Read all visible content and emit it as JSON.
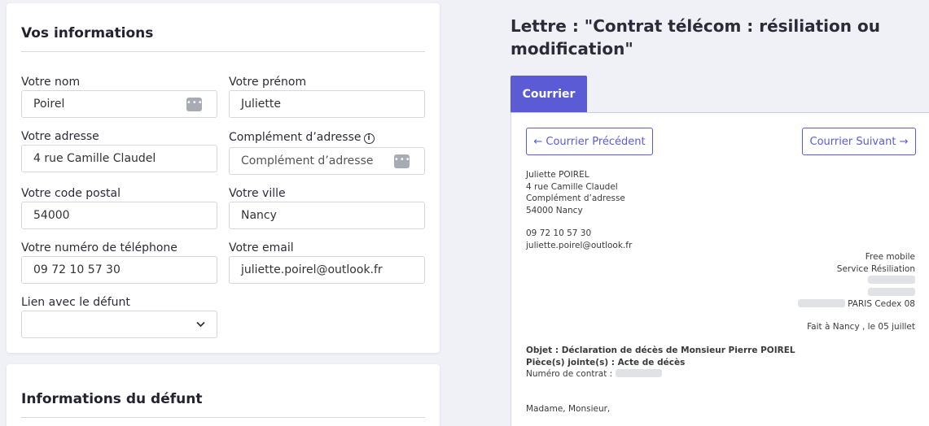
{
  "form": {
    "section_title": "Vos informations",
    "nom": {
      "label": "Votre nom",
      "value": "Poirel"
    },
    "prenom": {
      "label": "Votre prénom",
      "value": "Juliette"
    },
    "adresse": {
      "label": "Votre adresse",
      "value": "4 rue Camille Claudel"
    },
    "complement": {
      "label": "Complément d’adresse",
      "placeholder": "Complément d’adresse"
    },
    "code_postal": {
      "label": "Votre code postal",
      "value": "54000"
    },
    "ville": {
      "label": "Votre ville",
      "value": "Nancy"
    },
    "telephone": {
      "label": "Votre numéro de téléphone",
      "value": "09 72 10 57 30"
    },
    "email": {
      "label": "Votre email",
      "value": "juliette.poirel@outlook.fr"
    },
    "lien": {
      "label": "Lien avec le défunt",
      "value": ""
    }
  },
  "defunt": {
    "section_title": "Informations du défunt"
  },
  "letter": {
    "title": "Lettre : \"Contrat télécom : résiliation ou modification\"",
    "tab_label": "Courrier",
    "prev_label": "← Courrier Précédent",
    "next_label": "Courrier Suivant →",
    "sender": [
      "Juliette POIREL",
      "4 rue Camille Claudel",
      "Complément d’adresse",
      "54000 Nancy"
    ],
    "phone": "09 72 10 57 30",
    "email": "juliette.poirel@outlook.fr",
    "recipient_name": "Free mobile",
    "recipient_service": "Service Résiliation",
    "recipient_city": "PARIS Cedex 08",
    "place_date": "Fait à Nancy , le 05 juillet",
    "objet": "Objet : Déclaration de décès de Monsieur Pierre POIREL",
    "pieces": "Pièce(s) jointe(s) : Acte de décès",
    "contrat_label": "Numéro de contrat :",
    "salutation": "Madame, Monsieur,"
  },
  "icons": {
    "autofill": "autofill-dots-icon",
    "info": "info-icon",
    "chevron": "chevron-down-icon"
  },
  "colors": {
    "accent": "#5b5bd6",
    "background": "#f0f1f7"
  }
}
